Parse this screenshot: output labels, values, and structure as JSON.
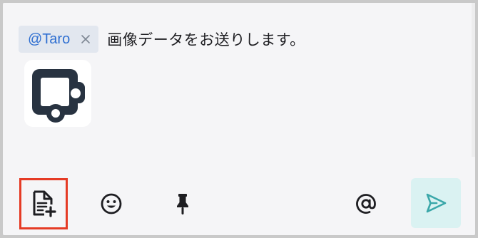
{
  "composer": {
    "mention": {
      "name": "@Taro",
      "remove_symbol": "×"
    },
    "message_text": "画像データをお送りします。",
    "attachment": {
      "icon": "image-placeholder-icon"
    }
  },
  "toolbar": {
    "attach_icon": "file-add-icon",
    "emoji_icon": "smiley-icon",
    "pin_icon": "pin-icon",
    "mention_icon": "at-sign-icon",
    "send_icon": "send-icon"
  },
  "colors": {
    "mention_text": "#2f6fd1",
    "highlight_border": "#e53b25",
    "send_background": "#daf2f2",
    "send_icon": "#3aa7a9"
  }
}
